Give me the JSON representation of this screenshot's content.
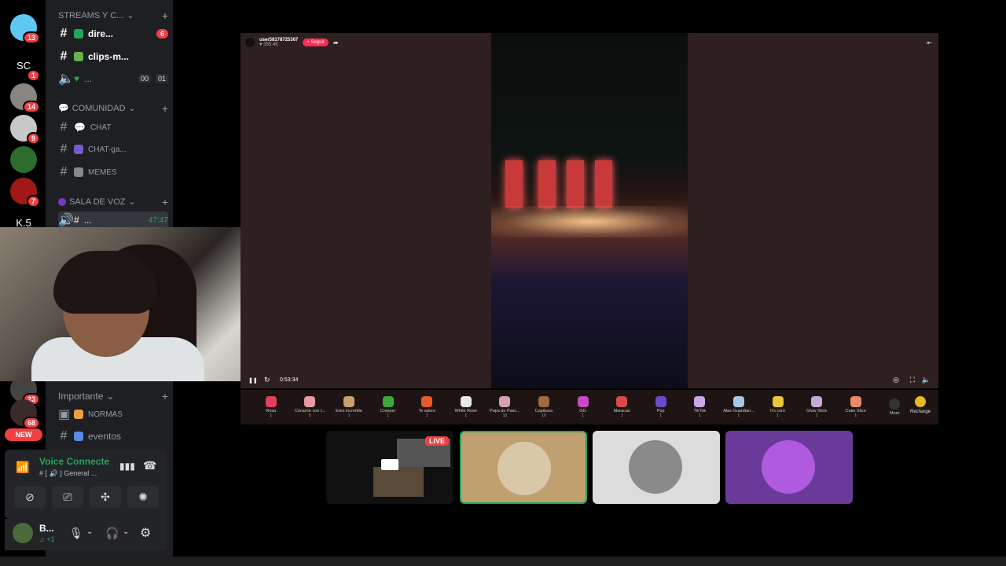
{
  "servers": [
    {
      "id": "s1",
      "badge": "13",
      "color": "#5ec8f0",
      "label": ""
    },
    {
      "id": "s2",
      "badge": "1",
      "color": "",
      "label": "SC"
    },
    {
      "id": "s3",
      "badge": "14",
      "color": "#8a8580",
      "label": ""
    },
    {
      "id": "s4",
      "badge": "9",
      "color": "#c8c8c8",
      "label": ""
    },
    {
      "id": "s5",
      "badge": "",
      "color": "#2e6b2e",
      "label": ""
    },
    {
      "id": "s6",
      "badge": "7",
      "color": "#a01818",
      "label": ""
    },
    {
      "id": "s7",
      "badge": "",
      "color": "",
      "label": "K.5"
    },
    {
      "id": "s8",
      "badge": "23",
      "color": "#444",
      "label": ""
    },
    {
      "id": "s9",
      "badge": "68",
      "color": "#3b2a2a",
      "label": ""
    }
  ],
  "new_label": "NEW",
  "categories": {
    "streams": "STREAMS Y C...",
    "comunidad": "COMUNIDAD",
    "sala_voz": "SALA DE VOZ",
    "importante": "Importante"
  },
  "channels": {
    "direct": {
      "name": "dire...",
      "count": "6"
    },
    "clips": {
      "name": "clips-m..."
    },
    "voice_stream": {
      "name": "...",
      "t1": "00",
      "t2": "01"
    },
    "chat": {
      "name": "CHAT"
    },
    "chat_ga": {
      "name": "CHAT-ga..."
    },
    "memes": {
      "name": "MEMES"
    },
    "voice_active": {
      "name": "...",
      "time": "47:47"
    },
    "normas": {
      "name": "NORMAS"
    },
    "eventos": {
      "name": "eventos"
    }
  },
  "voice": {
    "status": "Voice Connecte",
    "channel": "# [ 🔊 ] General ..."
  },
  "user": {
    "name": "B...",
    "sub": "♫ +1"
  },
  "stream": {
    "host_name": "user58178725367",
    "host_likes": "♥ 355.4K",
    "follow": "+ Seguir",
    "time": "0:53:34"
  },
  "gifts": [
    {
      "name": "Rosa",
      "price": "1",
      "color": "#e0405a"
    },
    {
      "name": "Corazón con l...",
      "price": "5",
      "color": "#e89aa0"
    },
    {
      "name": "Eres increíble",
      "price": "1",
      "color": "#c8a070"
    },
    {
      "name": "Creeper",
      "price": "1",
      "color": "#3aa83a"
    },
    {
      "name": "Te adoro",
      "price": "1",
      "color": "#e85a2a"
    },
    {
      "name": "White Rose",
      "price": "1",
      "color": "#e8e8e8"
    },
    {
      "name": "Papa de Pasc...",
      "price": "10",
      "color": "#d8a0b0"
    },
    {
      "name": "Capibara",
      "price": "10",
      "color": "#a06a40"
    },
    {
      "name": "GG",
      "price": "1",
      "color": "#c84ac8"
    },
    {
      "name": "Maracas",
      "price": "1",
      "color": "#d84a4a"
    },
    {
      "name": "Pop",
      "price": "1",
      "color": "#6a4ac8"
    },
    {
      "name": "TikTok",
      "price": "1",
      "color": "#c8a8e8"
    },
    {
      "name": "Alas Guardian...",
      "price": "1",
      "color": "#a8c8e8"
    },
    {
      "name": "It's corn",
      "price": "1",
      "color": "#e8c83a"
    },
    {
      "name": "Glow Stick",
      "price": "1",
      "color": "#c8a8d8"
    },
    {
      "name": "Cake Slice",
      "price": "1",
      "color": "#e88a6a"
    }
  ],
  "more_label": "More",
  "recharge_label": "Recharge",
  "tiles": {
    "live": "LIVE"
  },
  "colors": {
    "accent": "#fe2c55",
    "discord_bg": "#1e1f22",
    "voice_green": "#23a55a",
    "badge_red": "#f23f43"
  }
}
